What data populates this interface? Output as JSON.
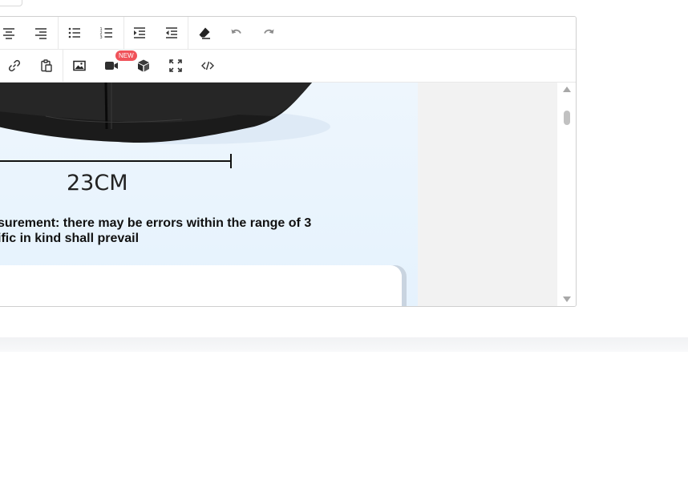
{
  "toolbar": {
    "row1": [
      {
        "name": "align-center-icon"
      },
      {
        "name": "align-right-icon"
      },
      {
        "name": "bulleted-list-icon"
      },
      {
        "name": "numbered-list-icon"
      },
      {
        "name": "indent-increase-icon"
      },
      {
        "name": "indent-decrease-icon"
      },
      {
        "name": "clear-format-icon"
      },
      {
        "name": "undo-icon"
      },
      {
        "name": "redo-icon"
      }
    ],
    "row2": [
      {
        "name": "link-icon"
      },
      {
        "name": "paste-icon"
      },
      {
        "name": "image-icon"
      },
      {
        "name": "video-icon"
      },
      {
        "name": "3d-model-icon"
      },
      {
        "name": "fullscreen-icon"
      },
      {
        "name": "source-code-icon"
      }
    ],
    "new_badge": "NEW"
  },
  "content": {
    "dimension_label": "23CM",
    "note_line1": "surement: there may be errors within the range of 3",
    "note_line2": "ific in kind shall prevail"
  },
  "colors": {
    "badge": "#f0535a",
    "image_bg": "#e5f2fd",
    "editor_border": "#cfcfcf"
  }
}
